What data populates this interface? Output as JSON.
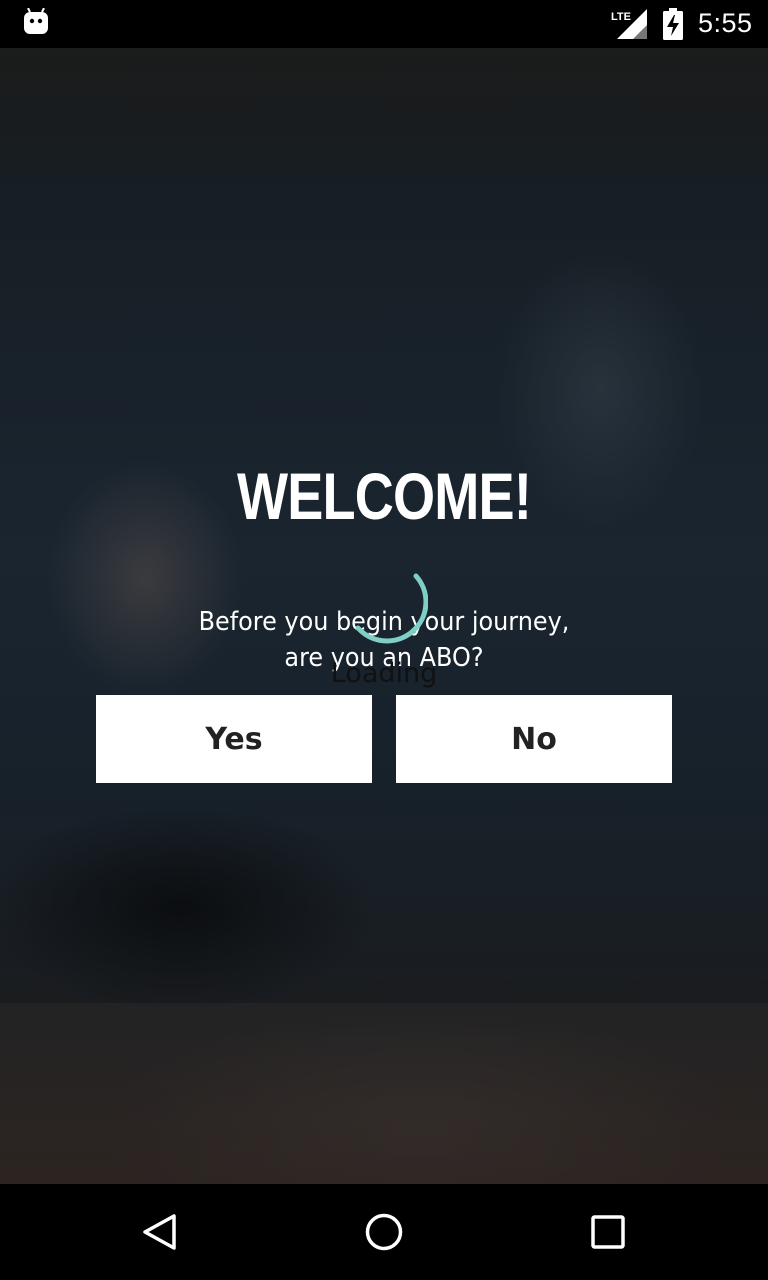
{
  "status_bar": {
    "time": "5:55",
    "network_label": "LTE",
    "icons": [
      "android-icon",
      "lte-signal-icon",
      "battery-charging-icon"
    ]
  },
  "welcome": {
    "title": "WELCOME!",
    "subtitle_line1": "Before you begin your journey,",
    "subtitle_line2": "are you an ABO?"
  },
  "loading": {
    "text": "Loading",
    "spinner_color": "#7fcfc7"
  },
  "buttons": {
    "yes_label": "Yes",
    "no_label": "No"
  },
  "nav_bar": {
    "icons": [
      "back-icon",
      "home-icon",
      "recents-icon"
    ]
  }
}
